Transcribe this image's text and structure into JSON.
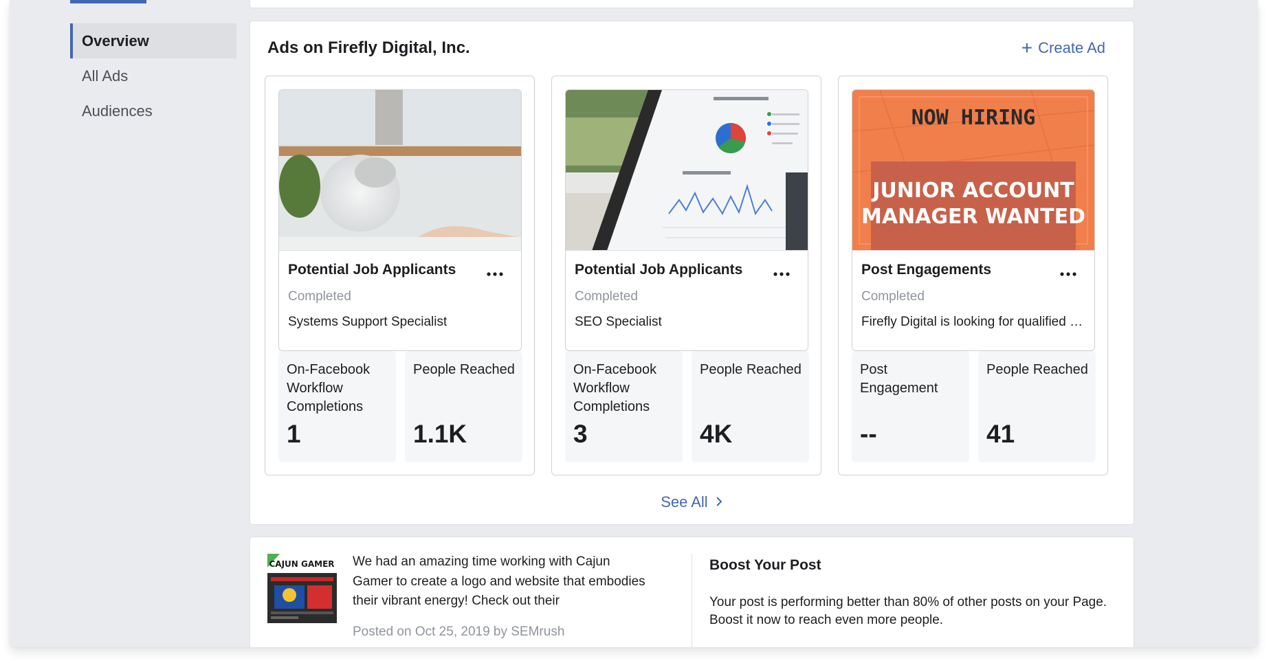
{
  "sidebar": {
    "items": [
      {
        "label": "Overview",
        "active": true
      },
      {
        "label": "All Ads",
        "active": false
      },
      {
        "label": "Audiences",
        "active": false
      }
    ]
  },
  "ads_section": {
    "title": "Ads on Firefly Digital, Inc.",
    "create_ad_label": "Create Ad",
    "create_ad_icon": "plus-icon",
    "see_all_label": "See All",
    "see_all_icon": "chevron-right-icon"
  },
  "ads": [
    {
      "name": "Potential Job Applicants",
      "status": "Completed",
      "description": "Systems Support Specialist",
      "image": "laptop-photo",
      "metrics": [
        {
          "label": "On-Facebook Workflow Completions",
          "value": "1"
        },
        {
          "label": "People Reached",
          "value": "1.1K"
        }
      ]
    },
    {
      "name": "Potential Job Applicants",
      "status": "Completed",
      "description": "SEO Specialist",
      "image": "analytics-tablet-photo",
      "metrics": [
        {
          "label": "On-Facebook Workflow Completions",
          "value": "3"
        },
        {
          "label": "People Reached",
          "value": "4K"
        }
      ]
    },
    {
      "name": "Post Engagements",
      "status": "Completed",
      "description": "Firefly Digital is looking for qualified candidates",
      "image": "now-hiring-graphic",
      "image_text": {
        "headline": "NOW HIRING",
        "subline_1": "JUNIOR ACCOUNT",
        "subline_2": "MANAGER WANTED"
      },
      "metrics": [
        {
          "label": "Post Engagement",
          "value": "--"
        },
        {
          "label": "People Reached",
          "value": "41"
        }
      ]
    }
  ],
  "post": {
    "thumbnail_brand": "CAJUN GAMER",
    "text": "We had an amazing time working with Cajun Gamer to create a logo and website that embodies their vibrant energy! Check out their",
    "meta": "Posted on Oct 25, 2019 by SEMrush"
  },
  "boost": {
    "title": "Boost Your Post",
    "text": "Your post is performing better than 80% of other posts on your Page. Boost it now to reach even more people."
  },
  "colors": {
    "accent": "#4267b2",
    "page_bg": "#e9ebee",
    "card_border": "#dddfe2",
    "muted_text": "#90949c",
    "metric_bg": "#f5f6f7",
    "hiring_orange": "#f07f4c"
  }
}
